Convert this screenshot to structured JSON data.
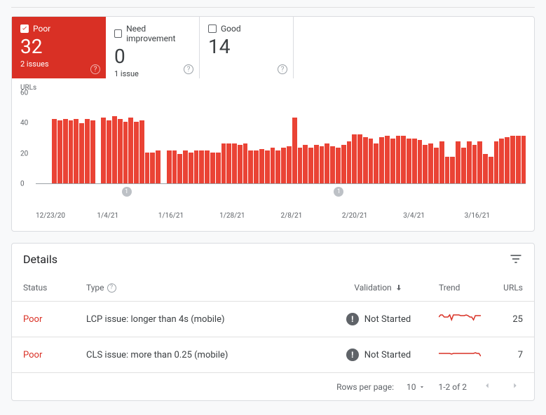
{
  "cards": [
    {
      "label": "Poor",
      "value": "32",
      "sub": "2 issues",
      "active": true
    },
    {
      "label": "Need improvement",
      "value": "0",
      "sub": "1 issue",
      "active": false
    },
    {
      "label": "Good",
      "value": "14",
      "sub": "",
      "active": false
    }
  ],
  "chart_data": {
    "type": "bar",
    "ylabel": "URLs",
    "ylim": [
      0,
      60
    ],
    "yticks": [
      0,
      20,
      40,
      60
    ],
    "categories": [
      "12/23/20",
      "1/4/21",
      "1/16/21",
      "1/28/21",
      "2/8/21",
      "2/20/21",
      "3/4/21",
      "3/16/21"
    ],
    "values": [
      null,
      null,
      null,
      43,
      42,
      43,
      42,
      43,
      40,
      43,
      42,
      null,
      44,
      42,
      45,
      43,
      41,
      44,
      41,
      42,
      21,
      21,
      22,
      null,
      22,
      22,
      20,
      22,
      21,
      22,
      22,
      22,
      21,
      21,
      27,
      27,
      27,
      26,
      27,
      22,
      22,
      23,
      22,
      24,
      22,
      24,
      25,
      44,
      24,
      26,
      24,
      26,
      25,
      27,
      25,
      24,
      26,
      28,
      33,
      33,
      31,
      30,
      27,
      31,
      32,
      30,
      32,
      32,
      30,
      30,
      29,
      26,
      27,
      24,
      28,
      18,
      18,
      28,
      24,
      28,
      26,
      28,
      20,
      18,
      28,
      30,
      31,
      32,
      32,
      32
    ],
    "annotations": [
      {
        "pos_pct": 17,
        "label": "1"
      },
      {
        "pos_pct": 59,
        "label": "1"
      }
    ]
  },
  "details": {
    "title": "Details",
    "columns": {
      "status": "Status",
      "type": "Type",
      "validation": "Validation",
      "trend": "Trend",
      "urls": "URLs"
    },
    "rows": [
      {
        "status": "Poor",
        "type": "LCP issue: longer than 4s (mobile)",
        "validation": "Not Started",
        "trend": [
          8,
          5,
          5,
          8,
          8,
          8,
          5,
          12,
          5,
          5,
          5,
          5,
          6,
          6,
          6,
          5,
          6,
          8,
          8,
          12,
          6,
          6,
          6,
          6
        ],
        "urls": "25"
      },
      {
        "status": "Poor",
        "type": "CLS issue: more than 0.25 (mobile)",
        "validation": "Not Started",
        "trend": [
          9,
          9,
          9,
          9,
          9,
          9,
          9,
          10,
          9,
          9,
          9,
          9,
          9,
          9,
          9,
          9,
          9,
          9,
          9,
          9,
          8,
          9,
          9,
          13
        ],
        "urls": "7"
      }
    ],
    "pager": {
      "rpp_label": "Rows per page:",
      "rpp_value": "10",
      "range": "1-2 of 2"
    }
  }
}
